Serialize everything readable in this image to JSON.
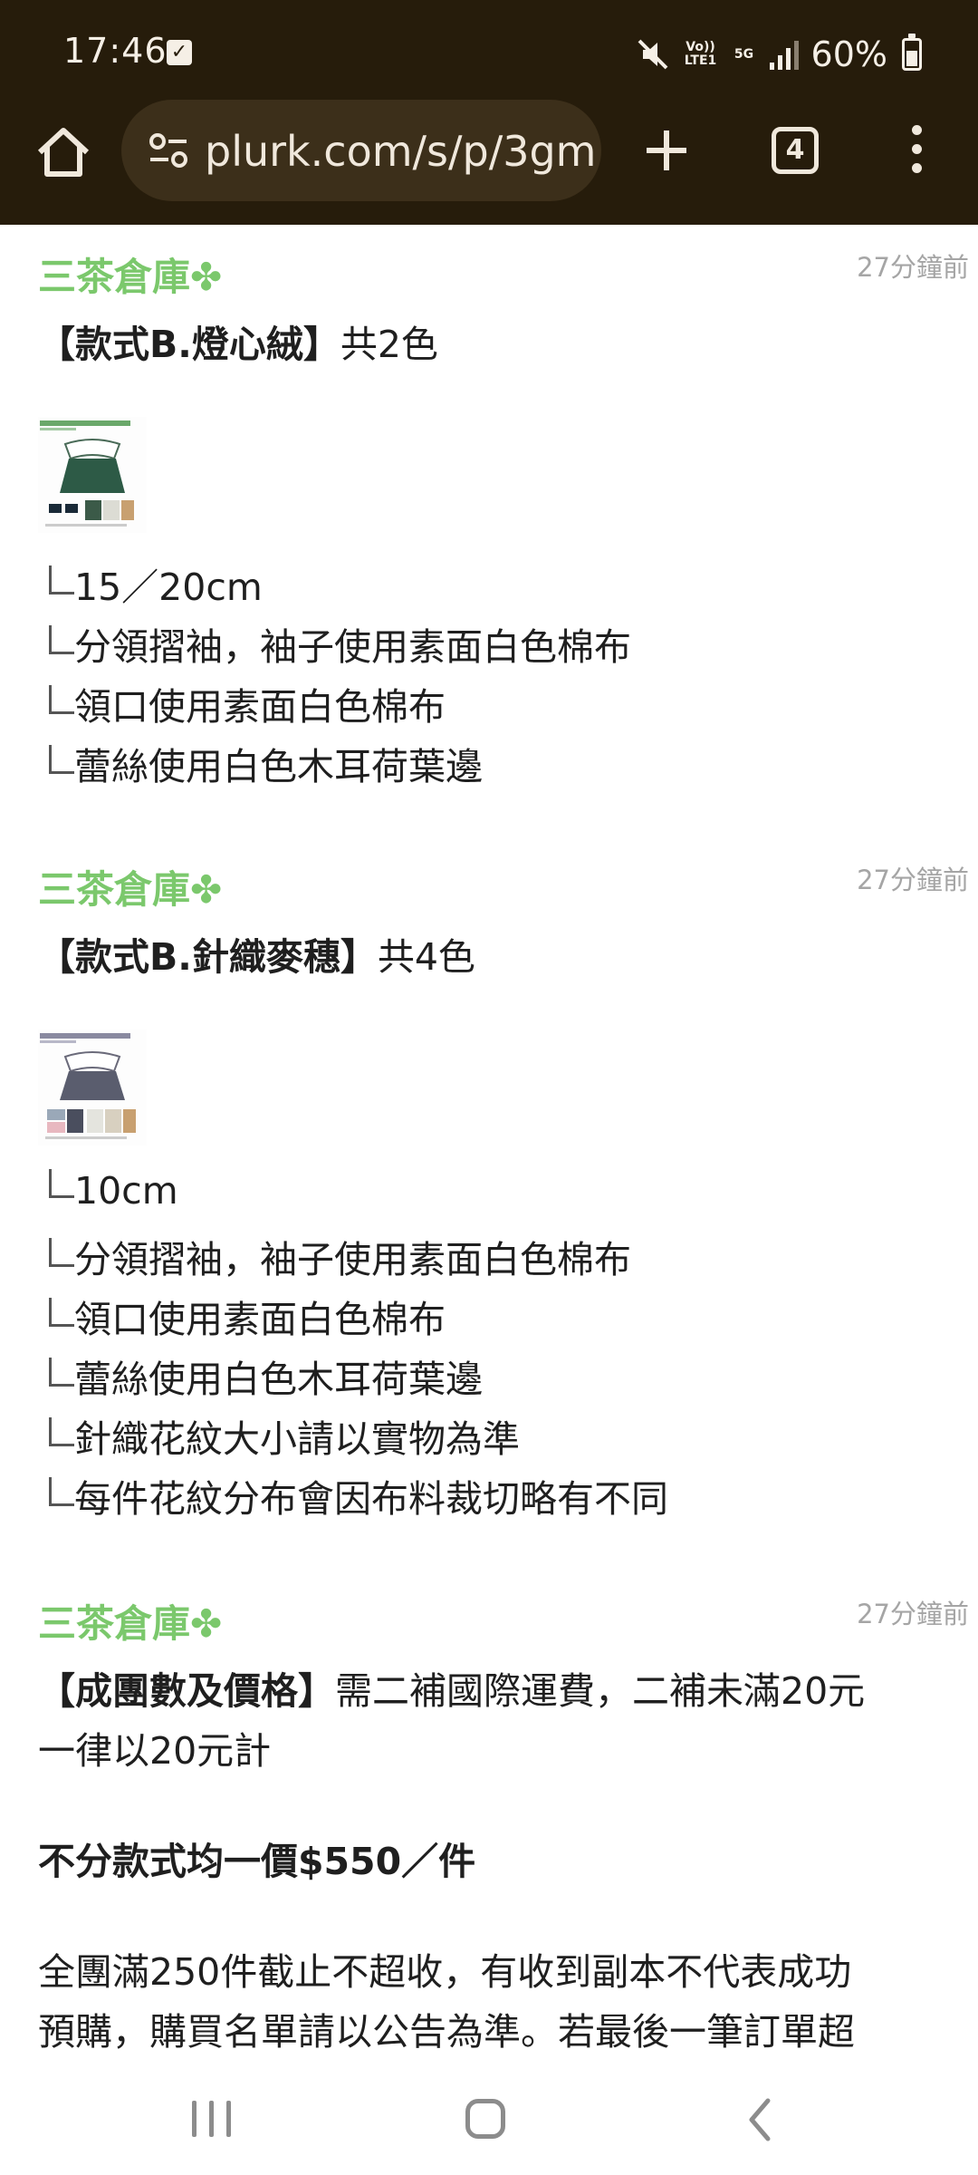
{
  "status": {
    "time": "17:46",
    "network_volte": "Vo)) LTE1",
    "network_5g": "5G",
    "battery": "60%"
  },
  "browser": {
    "url": "plurk.com/s/p/3gm",
    "tab_count": "4"
  },
  "posts": [
    {
      "author": "三茶倉庫",
      "time": "27分鐘前",
      "title_bold": "【款式B.燈心絨】",
      "title_rest": "共2色",
      "thumb_alt": "B款燈心絨二色",
      "items": [
        "15／20cm",
        "分領摺袖，袖子使用素面白色棉布",
        "領口使用素面白色棉布",
        "蕾絲使用白色木耳荷葉邊"
      ]
    },
    {
      "author": "三茶倉庫",
      "time": "27分鐘前",
      "title_bold": "【款式B.針織麥穗】",
      "title_rest": "共4色",
      "thumb_alt": "C款針織麥穗四色",
      "items": [
        "10cm",
        "分領摺袖，袖子使用素面白色棉布",
        "領口使用素面白色棉布",
        "蕾絲使用白色木耳荷葉邊",
        "針織花紋大小請以實物為準",
        "每件花紋分布會因布料裁切略有不同"
      ]
    },
    {
      "author": "三茶倉庫",
      "time": "27分鐘前",
      "title_bold": "【成團數及價格】",
      "title_rest": "需二補國際運費，二補未滿20元",
      "title_line2": "一律以20元計",
      "price_line": "不分款式均一價$550／件",
      "para_line1": "全團滿250件截止不超收，有收到副本不代表成功",
      "para_line2": "預購，購買名單請以公告為準。若最後一筆訂單超"
    }
  ]
}
